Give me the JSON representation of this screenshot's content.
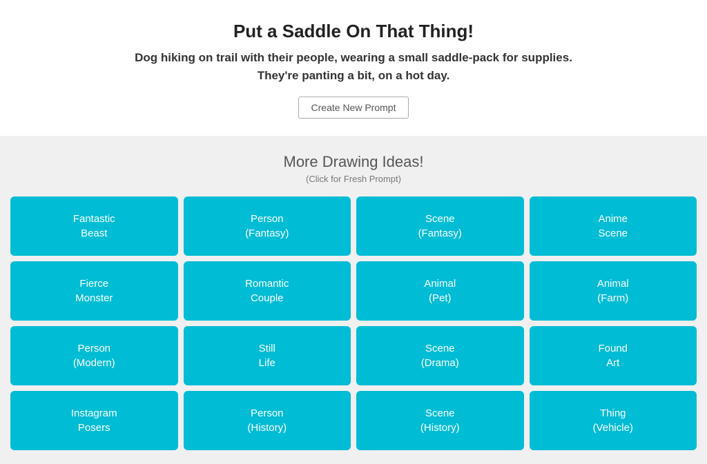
{
  "header": {
    "main_title": "Put a Saddle On That Thing!",
    "subtitle_line1": "Dog hiking on trail with their people, wearing a small saddle-pack for supplies.",
    "subtitle_line2": "They're panting a bit, on a hot day.",
    "create_button_label": "Create New Prompt"
  },
  "ideas": {
    "section_title": "More Drawing Ideas!",
    "section_subtitle": "(Click for Fresh Prompt)",
    "cards": [
      {
        "line1": "Fantastic",
        "line2": "Beast"
      },
      {
        "line1": "Person",
        "line2": "(Fantasy)"
      },
      {
        "line1": "Scene",
        "line2": "(Fantasy)"
      },
      {
        "line1": "Anime",
        "line2": "Scene"
      },
      {
        "line1": "Fierce",
        "line2": "Monster"
      },
      {
        "line1": "Romantic",
        "line2": "Couple"
      },
      {
        "line1": "Animal",
        "line2": "(Pet)"
      },
      {
        "line1": "Animal",
        "line2": "(Farm)"
      },
      {
        "line1": "Person",
        "line2": "(Modern)"
      },
      {
        "line1": "Still",
        "line2": "Life"
      },
      {
        "line1": "Scene",
        "line2": "(Drama)"
      },
      {
        "line1": "Found",
        "line2": "Art"
      },
      {
        "line1": "Instagram",
        "line2": "Posers"
      },
      {
        "line1": "Person",
        "line2": "(History)"
      },
      {
        "line1": "Scene",
        "line2": "(History)"
      },
      {
        "line1": "Thing",
        "line2": "(Vehicle)"
      }
    ]
  }
}
